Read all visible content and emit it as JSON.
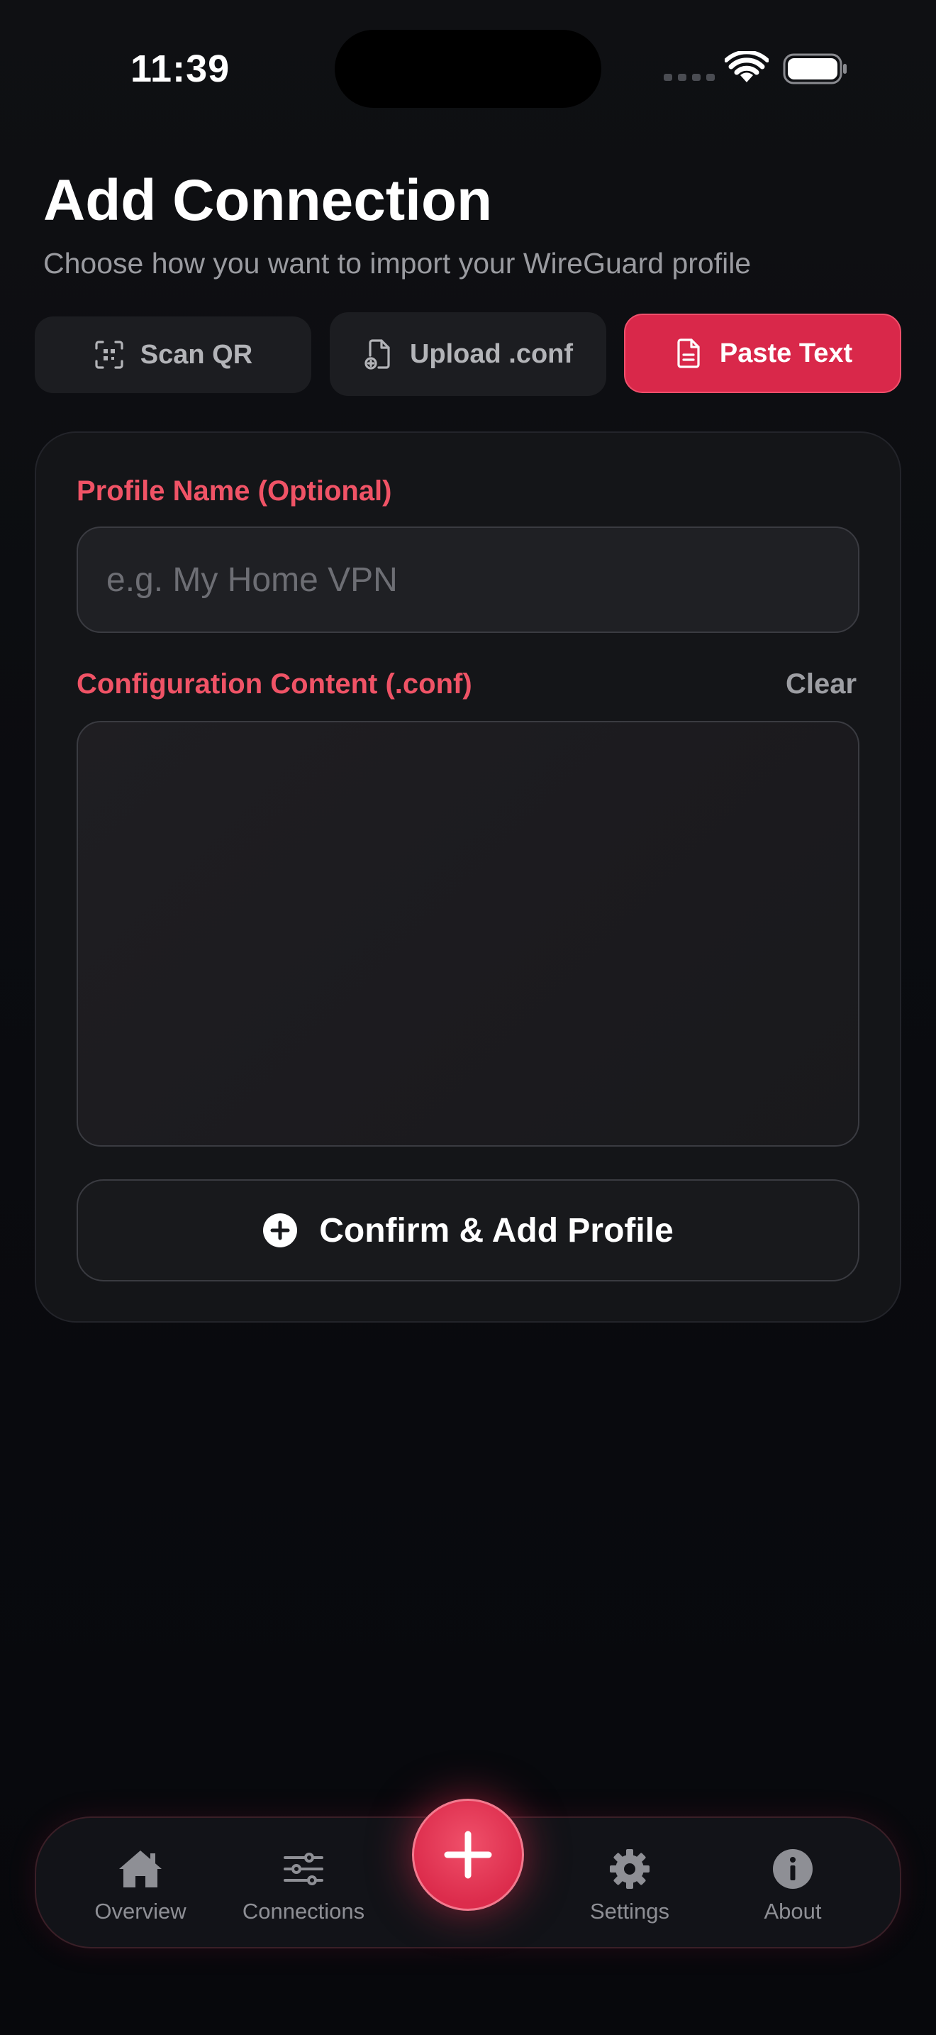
{
  "status_bar": {
    "time": "11:39"
  },
  "header": {
    "title": "Add Connection",
    "subtitle": "Choose how you want to import your WireGuard profile"
  },
  "tabs": [
    {
      "label": "Scan QR",
      "icon": "qr-scan-icon",
      "selected": false
    },
    {
      "label": "Upload .conf",
      "icon": "file-upload-icon",
      "selected": false
    },
    {
      "label": "Paste Text",
      "icon": "document-icon",
      "selected": true
    }
  ],
  "form": {
    "profile_name_label": "Profile Name (Optional)",
    "profile_name_placeholder": "e.g. My Home VPN",
    "profile_name_value": "",
    "config_label": "Configuration Content (.conf)",
    "clear_label": "Clear",
    "config_value": "",
    "confirm_label": "Confirm & Add Profile"
  },
  "nav": {
    "items": [
      {
        "label": "Overview",
        "icon": "home-icon"
      },
      {
        "label": "Connections",
        "icon": "sliders-icon"
      },
      {
        "label": "Settings",
        "icon": "gear-icon"
      },
      {
        "label": "About",
        "icon": "info-icon"
      }
    ],
    "fab_icon": "plus-icon"
  },
  "colors": {
    "accent": "#d9284a",
    "label": "#f05366",
    "background": "#0b0c10",
    "card": "#141518"
  }
}
